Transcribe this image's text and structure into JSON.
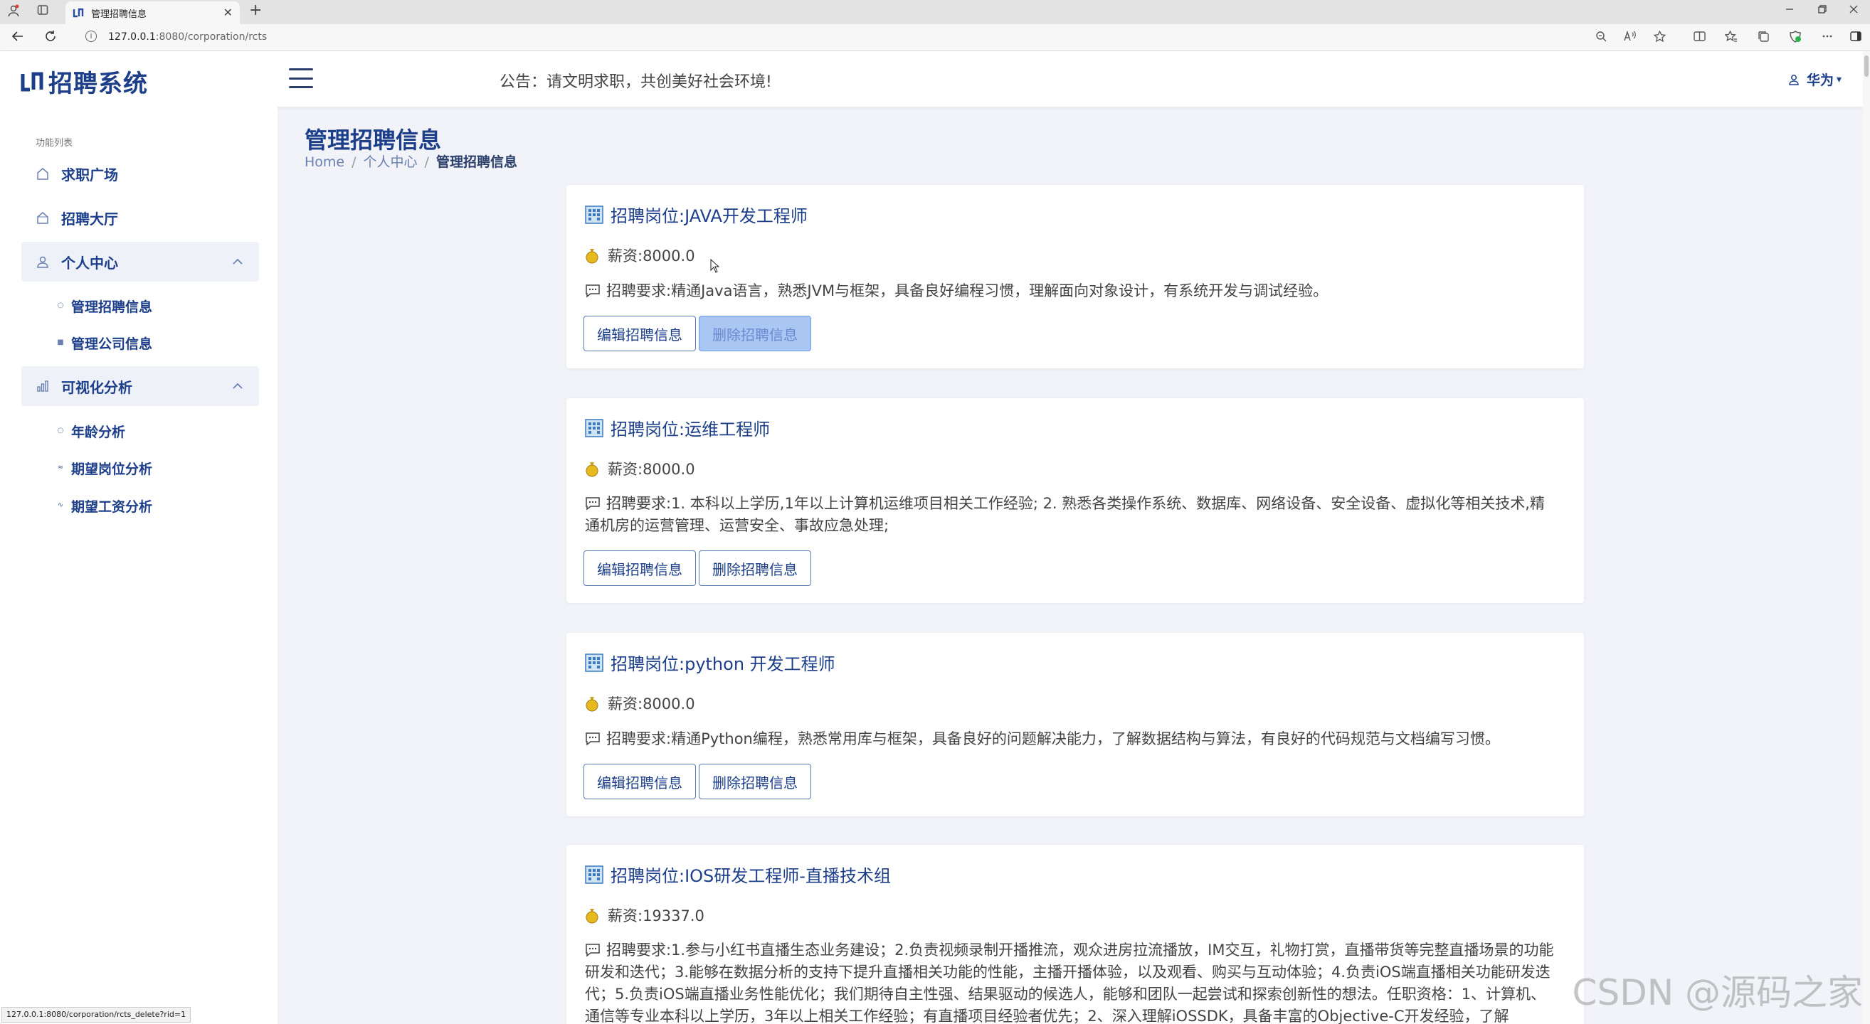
{
  "browser": {
    "tab_title": "管理招聘信息",
    "tab_close": "✕",
    "new_tab": "+",
    "url_host": "127.0.0.1",
    "url_path": ":8080/corporation/rcts",
    "status_url": "127.0.0.1:8080/corporation/rcts_delete?rid=1"
  },
  "header": {
    "logo_text": "招聘系统",
    "notice": "公告：请文明求职，共创美好社会环境!",
    "user_name": "华为",
    "user_caret": "▾"
  },
  "sidebar": {
    "caption": "功能列表",
    "items": [
      {
        "label": "求职广场",
        "icon": "home-icon"
      },
      {
        "label": "招聘大厅",
        "icon": "home-outline-icon"
      },
      {
        "label": "个人中心",
        "icon": "user-icon",
        "expanded": true,
        "children": [
          {
            "label": "管理招聘信息"
          },
          {
            "label": "管理公司信息"
          }
        ]
      },
      {
        "label": "可视化分析",
        "icon": "bar-chart-icon",
        "expanded": true,
        "children": [
          {
            "label": "年龄分析"
          },
          {
            "label": "期望岗位分析"
          },
          {
            "label": "期望工资分析"
          }
        ]
      }
    ]
  },
  "page": {
    "title": "管理招聘信息",
    "breadcrumb": [
      "Home",
      "个人中心",
      "管理招聘信息"
    ]
  },
  "cards": [
    {
      "title": "招聘岗位:JAVA开发工程师",
      "salary": "薪资:8000.0",
      "requirement": "招聘要求:精通Java语言，熟悉JVM与框架，具备良好编程习惯，理解面向对象设计，有系统开发与调试经验。",
      "edit_label": "编辑招聘信息",
      "delete_label": "删除招聘信息"
    },
    {
      "title": "招聘岗位:运维工程师",
      "salary": "薪资:8000.0",
      "requirement": "招聘要求:1. 本科以上学历,1年以上计算机运维项目相关工作经验; 2. 熟悉各类操作系统、数据库、网络设备、安全设备、虚拟化等相关技术,精通机房的运营管理、运营安全、事故应急处理;",
      "edit_label": "编辑招聘信息",
      "delete_label": "删除招聘信息"
    },
    {
      "title": "招聘岗位:python 开发工程师",
      "salary": "薪资:8000.0",
      "requirement": "招聘要求:精通Python编程，熟悉常用库与框架，具备良好的问题解决能力，了解数据结构与算法，有良好的代码规范与文档编写习惯。",
      "edit_label": "编辑招聘信息",
      "delete_label": "删除招聘信息"
    },
    {
      "title": "招聘岗位:IOS研发工程师-直播技术组",
      "salary": "薪资:19337.0",
      "requirement": "招聘要求:1.参与小红书直播生态业务建设；2.负责视频录制开播推流，观众进房拉流播放，IM交互，礼物打赏，直播带货等完整直播场景的功能研发和迭代；3.能够在数据分析的支持下提升直播相关功能的性能，主播开播体验，以及观看、购买与互动体验；4.负责iOS端直播相关功能研发迭代；5.负责iOS端直播业务性能优化；我们期待自主性强、结果驱动的候选人，能够和团队一起尝试和探索创新性的想法。任职资格：1、计算机、通信等专业本科以上学历，3年以上相关工作经验；有直播项目经验者优先；2、深入理解iOSSDK，具备丰富的Objective-C开发经验，了解Swift，精通各种UI控件"
    }
  ],
  "watermark": "CSDN @源码之家",
  "colors": {
    "brand": "#1d3f8a",
    "accent_link": "#6a80b0",
    "pressed_button": "#aac6f3"
  }
}
